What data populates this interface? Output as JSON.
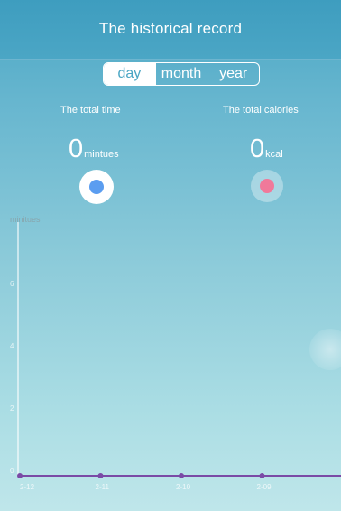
{
  "header": {
    "title": "The historical record"
  },
  "period_selector": {
    "options": [
      "day",
      "month",
      "year"
    ],
    "selected": "day"
  },
  "stats": {
    "time": {
      "label": "The total time",
      "value": "0",
      "unit": "mintues",
      "indicator_color": "#5b9df0"
    },
    "calories": {
      "label": "The total calories",
      "value": "0",
      "unit": "kcal",
      "indicator_color": "#f0799a"
    }
  },
  "chart_data": {
    "type": "line",
    "ylabel": "minitues",
    "yticks": [
      "0",
      "2",
      "4",
      "6"
    ],
    "categories": [
      "2-12",
      "2-11",
      "2-10",
      "2-09"
    ],
    "series": [
      {
        "values": [
          0,
          0,
          0,
          0
        ]
      }
    ],
    "ylim": [
      0,
      6
    ],
    "line_color": "#7a4aa6"
  }
}
